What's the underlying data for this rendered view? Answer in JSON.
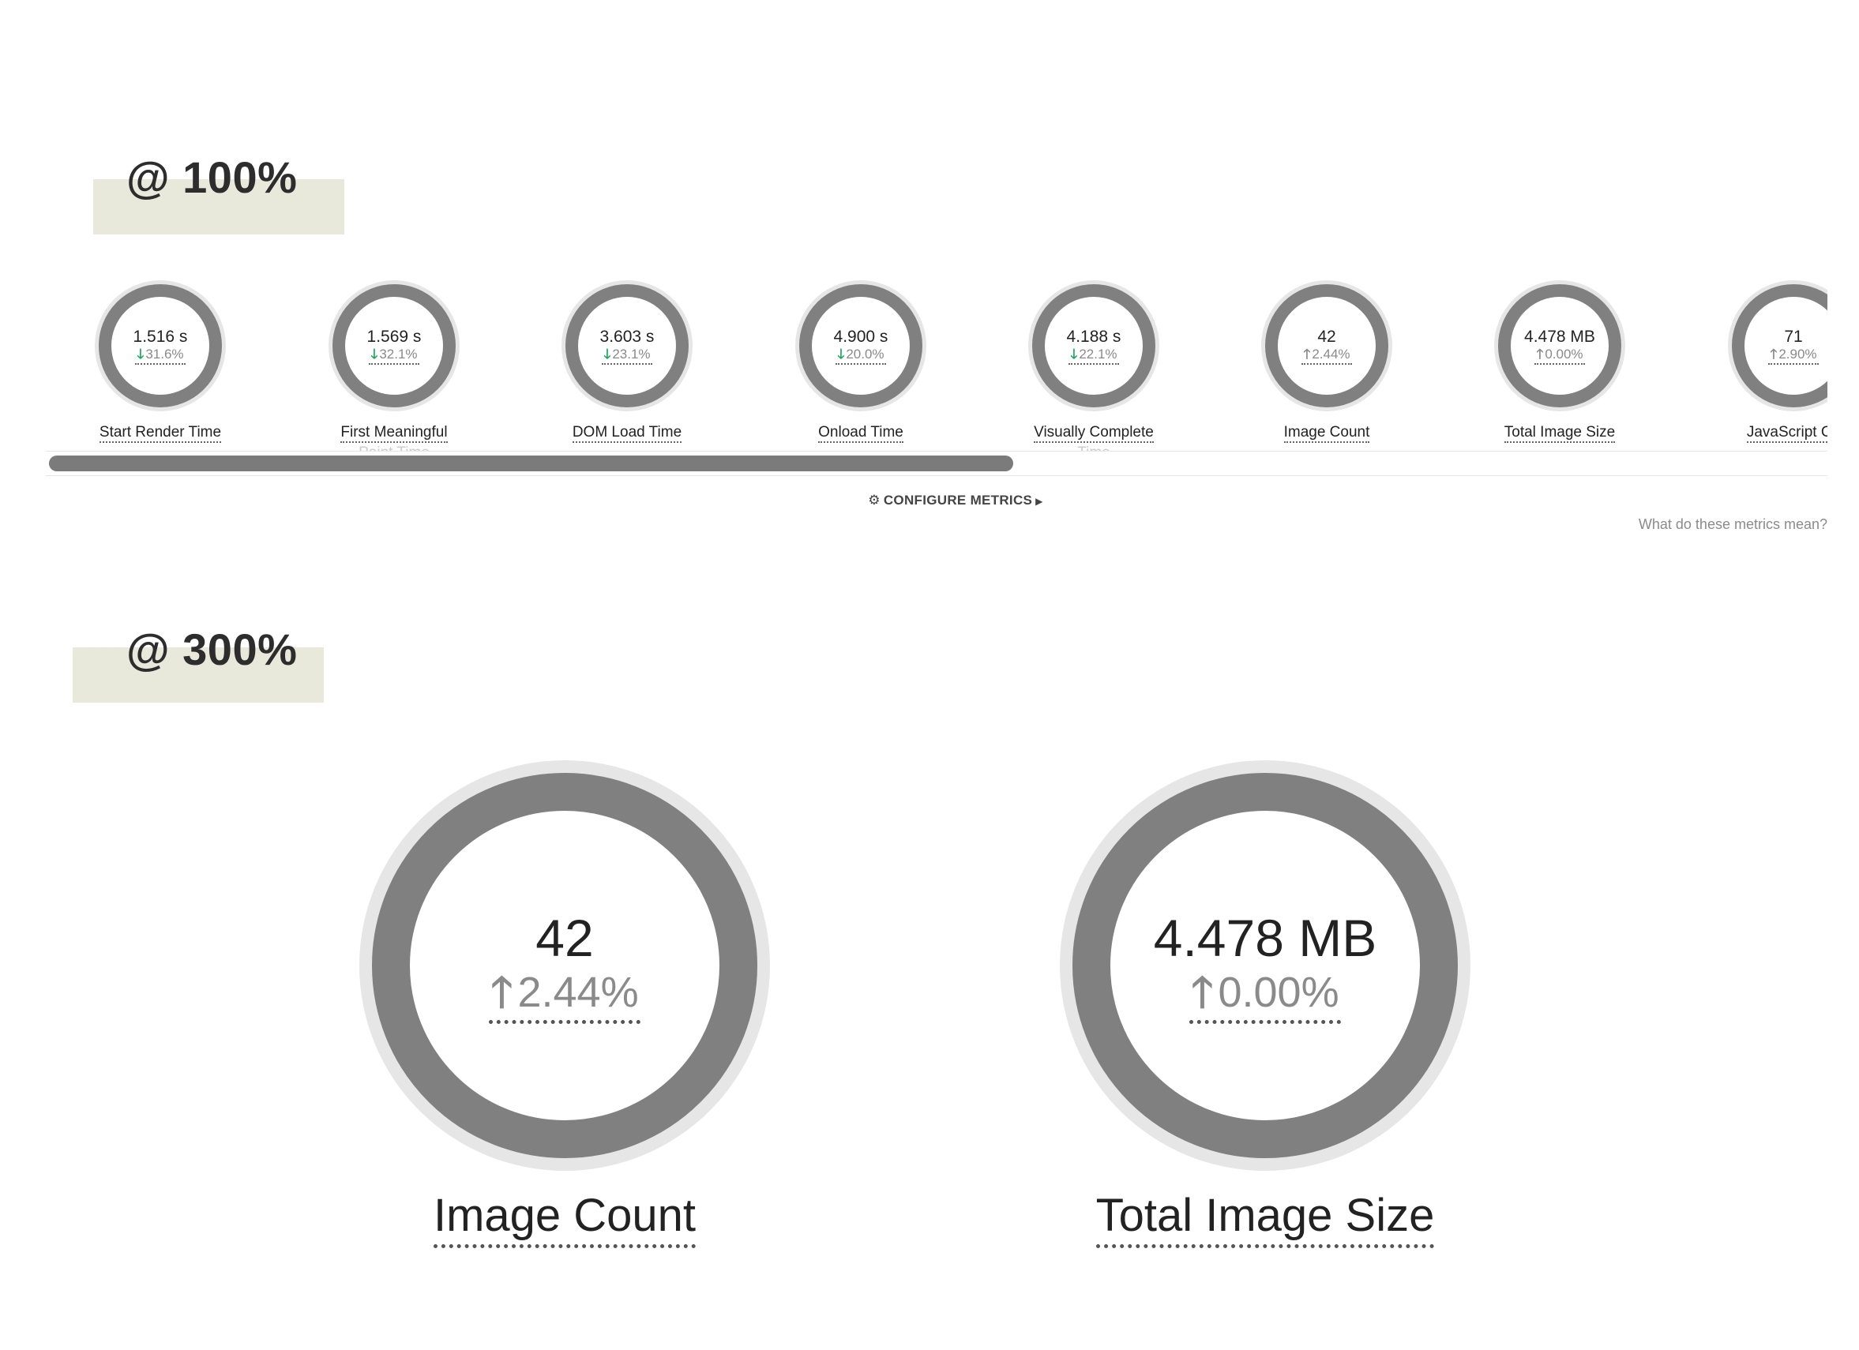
{
  "headings": {
    "zoom_100": "@ 100%",
    "zoom_300": "@ 300%"
  },
  "metrics": [
    {
      "value": "1.516 s",
      "change": "31.6%",
      "direction": "down",
      "label": "Start Render Time"
    },
    {
      "value": "1.569 s",
      "change": "32.1%",
      "direction": "down",
      "label": "First Meaningful",
      "label_overflow": "Paint Time"
    },
    {
      "value": "3.603 s",
      "change": "23.1%",
      "direction": "down",
      "label": "DOM Load Time"
    },
    {
      "value": "4.900 s",
      "change": "20.0%",
      "direction": "down",
      "label": "Onload Time"
    },
    {
      "value": "4.188 s",
      "change": "22.1%",
      "direction": "down",
      "label": "Visually Complete",
      "label_overflow": "Time"
    },
    {
      "value": "42",
      "change": "2.44%",
      "direction": "up",
      "label": "Image Count"
    },
    {
      "value": "4.478 MB",
      "change": "0.00%",
      "direction": "up",
      "label": "Total Image Size"
    },
    {
      "value": "71",
      "change": "2.90%",
      "direction": "up",
      "label": "JavaScript Co"
    }
  ],
  "configure": {
    "label": "CONFIGURE METRICS",
    "icon": "gear-icon"
  },
  "metrics_help": "What do these metrics mean?",
  "large_metrics": [
    {
      "value": "42",
      "change": "2.44%",
      "direction": "up",
      "label": "Image Count"
    },
    {
      "value": "4.478 MB",
      "change": "0.00%",
      "direction": "up",
      "label": "Total Image Size"
    }
  ],
  "colors": {
    "ring": "#808080",
    "ring_outer": "#e6e6e6",
    "down_arrow": "#19a85b",
    "up_arrow": "#8a8a8a",
    "heading_highlight": "#e8e8db"
  }
}
